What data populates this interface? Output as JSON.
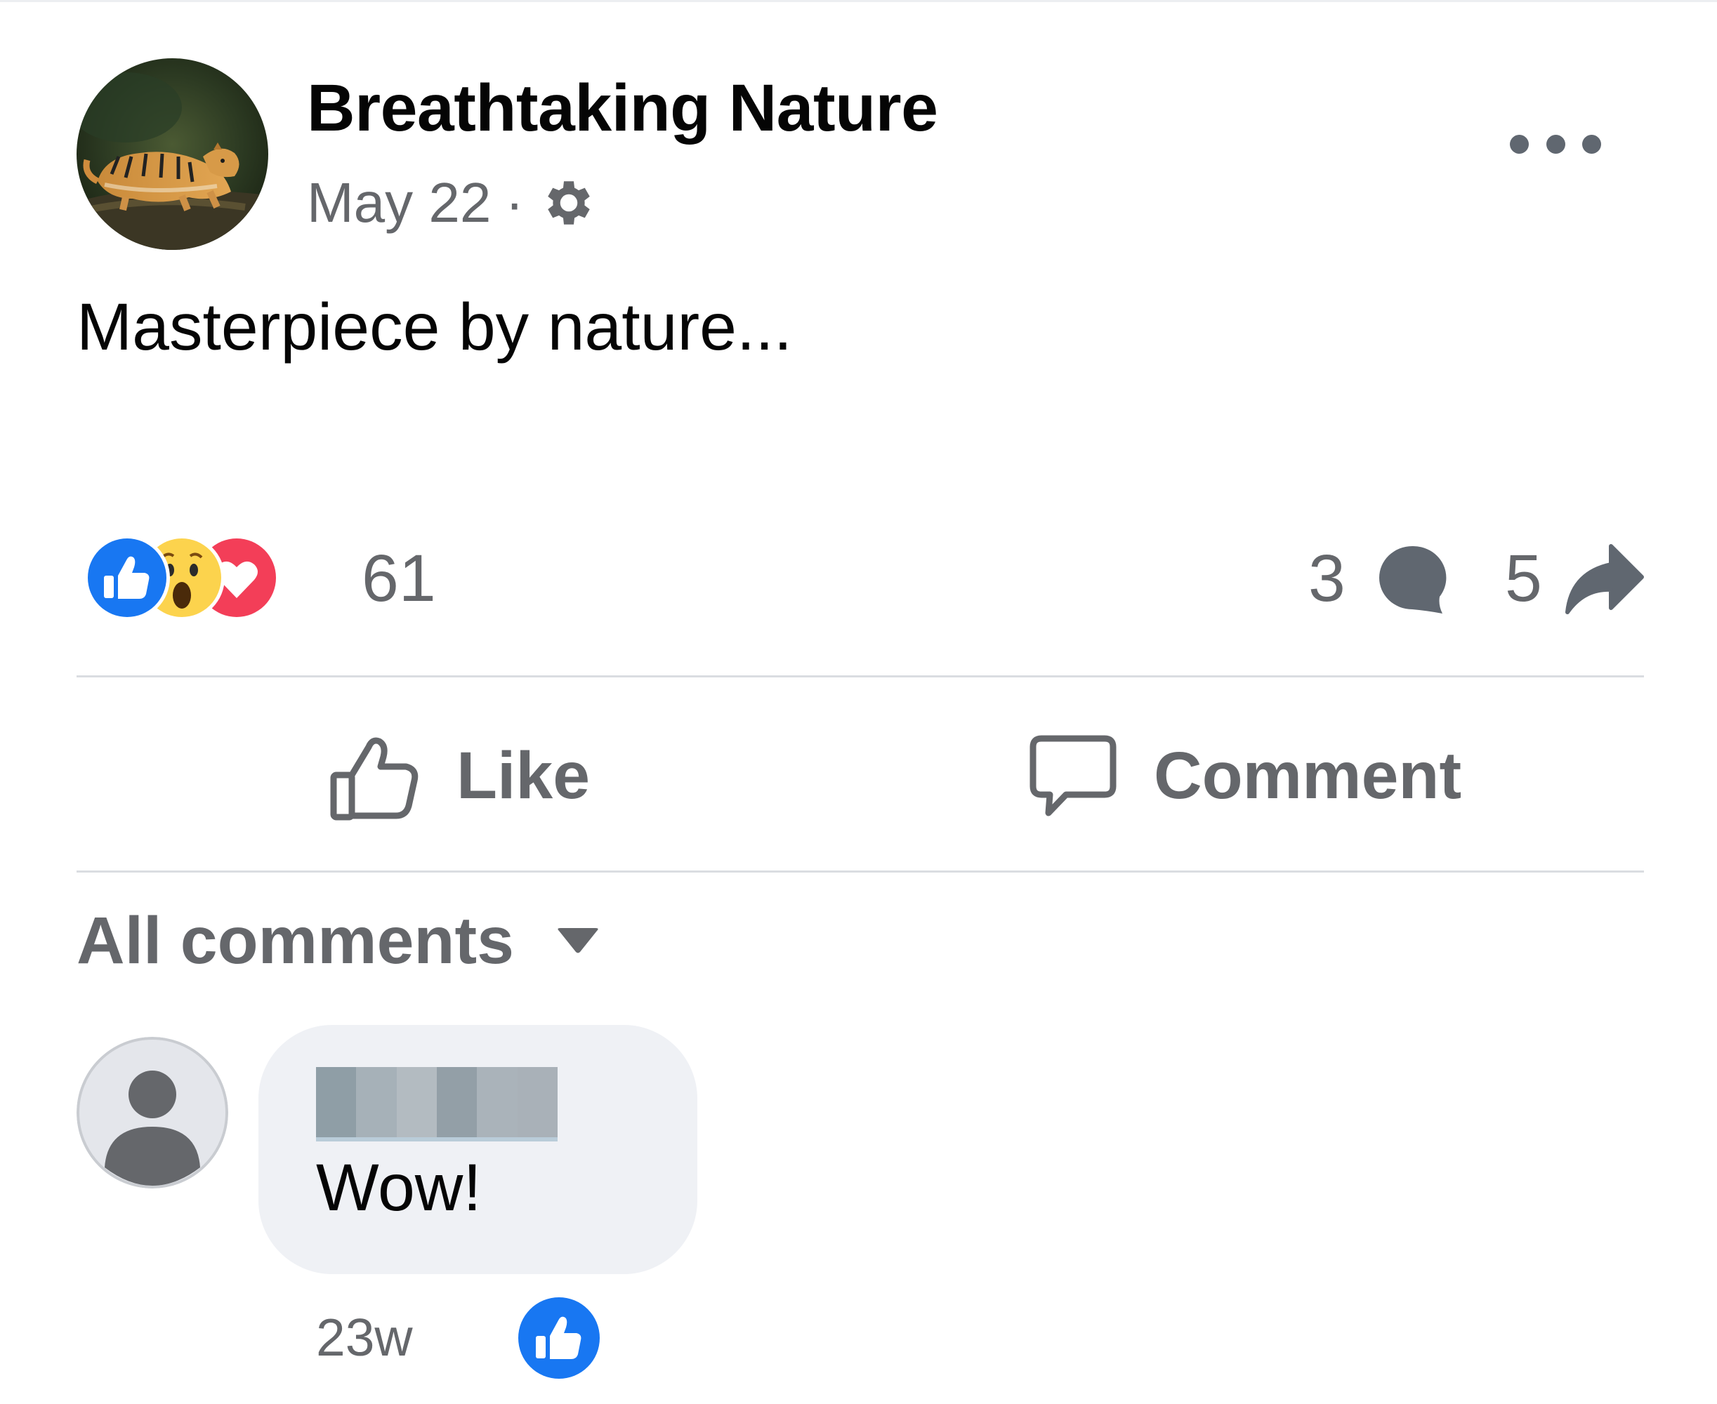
{
  "post": {
    "page_name": "Breathtaking Nature",
    "date": "May 22",
    "separator": "·",
    "audience_icon": "gear-icon",
    "text": "Masterpiece by nature...",
    "more_icon": "more-dots-icon"
  },
  "reactions": {
    "types": [
      "like-icon",
      "wow-icon",
      "love-icon"
    ],
    "count": "61",
    "comments_count": "3",
    "shares_count": "5"
  },
  "actions": {
    "like_label": "Like",
    "comment_label": "Comment"
  },
  "comments_filter": {
    "label": "All comments"
  },
  "comments": [
    {
      "author": "",
      "text": "Wow!",
      "time": "23w",
      "reaction": "like-icon"
    }
  ],
  "colors": {
    "like_blue": "#1877f2",
    "love_red": "#f33e58",
    "wow_yellow": "#fcd34d",
    "secondary_text": "#65676b",
    "bubble_bg": "#eff1f5"
  }
}
